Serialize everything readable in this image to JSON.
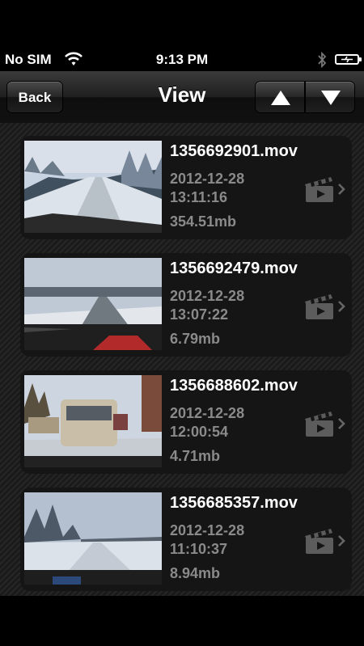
{
  "status_bar": {
    "carrier": "No SIM",
    "time": "9:13 PM",
    "icons": [
      "wifi-icon",
      "bluetooth-icon",
      "battery-charging-icon"
    ]
  },
  "nav_bar": {
    "back_label": "Back",
    "title": "View",
    "up_icon": "arrow-up-icon",
    "down_icon": "arrow-down-icon"
  },
  "videos": [
    {
      "filename": "1356692901.mov",
      "date": "2012-12-28",
      "time": "13:11:16",
      "size": "354.51mb"
    },
    {
      "filename": "1356692479.mov",
      "date": "2012-12-28",
      "time": "13:07:22",
      "size": "6.79mb"
    },
    {
      "filename": "1356688602.mov",
      "date": "2012-12-28",
      "time": "12:00:54",
      "size": "4.71mb"
    },
    {
      "filename": "1356685357.mov",
      "date": "2012-12-28",
      "time": "11:10:37",
      "size": "8.94mb"
    }
  ],
  "colors": {
    "background": "#1c1c1c",
    "row": "#151515",
    "secondary_text": "#8a8a8a"
  }
}
